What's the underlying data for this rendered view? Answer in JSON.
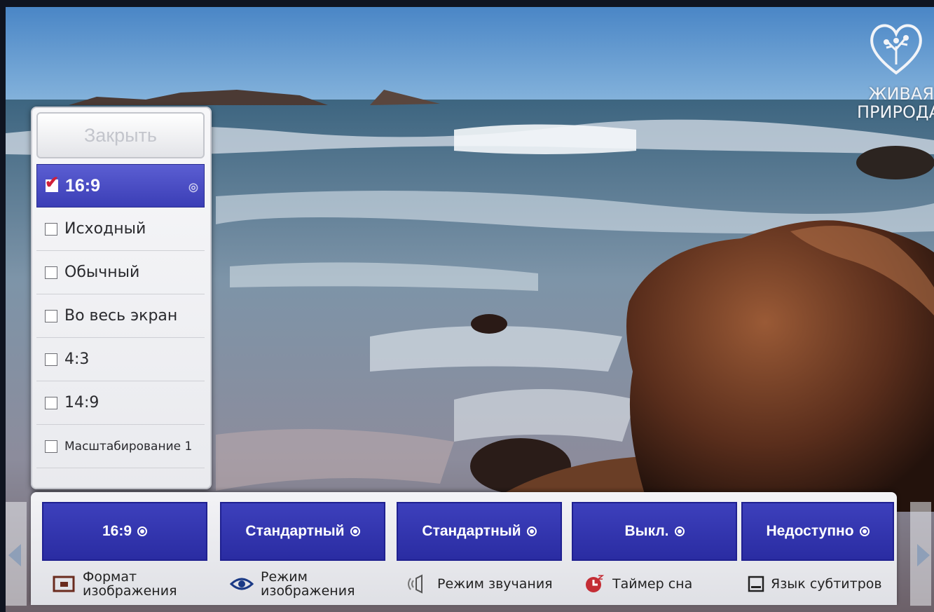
{
  "channel_logo": {
    "line1": "ЖИВАЯ",
    "line2": "ПРИРОДА",
    "icon": "heart-tree-icon"
  },
  "aspect_menu": {
    "close_label": "Закрыть",
    "options": [
      {
        "label": "16:9",
        "checked": true
      },
      {
        "label": "Исходный",
        "checked": false
      },
      {
        "label": "Обычный",
        "checked": false
      },
      {
        "label": "Во весь экран",
        "checked": false
      },
      {
        "label": "4:3",
        "checked": false
      },
      {
        "label": "14:9",
        "checked": false
      },
      {
        "label": "Масштабирование 1",
        "checked": false
      }
    ]
  },
  "quick_menu": {
    "items": [
      {
        "value": "16:9",
        "label": "Формат изображения",
        "icon": "aspect-ratio-icon"
      },
      {
        "value": "Стандартный",
        "label": "Режим изображения",
        "icon": "eye-icon"
      },
      {
        "value": "Стандартный",
        "label": "Режим звучания",
        "icon": "speaker-icon"
      },
      {
        "value": "Выкл.",
        "label": "Таймер сна",
        "icon": "sleep-timer-icon"
      },
      {
        "value": "Недоступно",
        "label": "Язык субтитров",
        "icon": "subtitle-icon"
      }
    ]
  },
  "colors": {
    "selected": "#3b3eb6",
    "check": "#d0203a"
  }
}
